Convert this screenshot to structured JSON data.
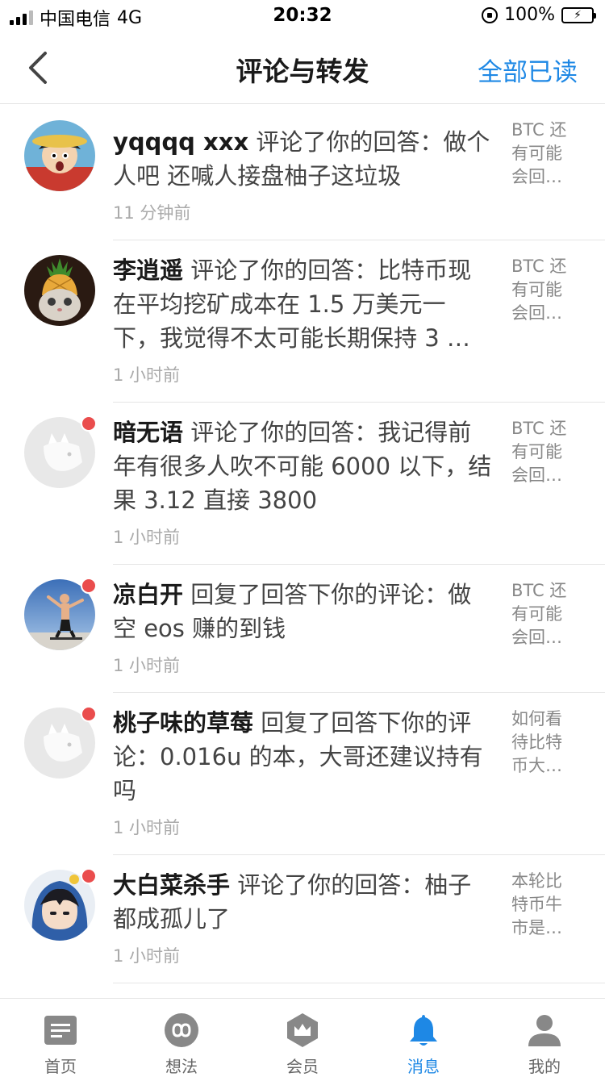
{
  "status_bar": {
    "carrier": "中国电信",
    "network": "4G",
    "time": "20:32",
    "battery": "100%"
  },
  "nav": {
    "title": "评论与转发",
    "action": "全部已读"
  },
  "notifications": [
    {
      "user": "yqqqq xxx",
      "action": "评论了你的回答：",
      "text": "做个人吧 还喊人接盘柚子这垃圾",
      "time": "11 分钟前",
      "source": "BTC 还有可能会回…",
      "unread": false,
      "avatar": "one-piece-avatar"
    },
    {
      "user": "李逍遥",
      "action": "评论了你的回答：",
      "text": "比特币现在平均挖矿成本在 1.5 万美元一下，我觉得不太可能长期保持 3 …",
      "time": "1 小时前",
      "source": "BTC 还有可能会回…",
      "unread": false,
      "avatar": "pineapple-cat-avatar"
    },
    {
      "user": "暗无语",
      "action": "评论了你的回答：",
      "text": "我记得前年有很多人吹不可能 6000 以下，结果 3.12 直接 3800",
      "time": "1 小时前",
      "source": "BTC 还有可能会回…",
      "unread": true,
      "avatar": "default-avatar"
    },
    {
      "user": "凉白开",
      "action": "回复了回答下你的评论：",
      "text": "做空 eos 赚的到钱",
      "time": "1 小时前",
      "source": "BTC 还有可能会回…",
      "unread": true,
      "avatar": "skateboarder-avatar"
    },
    {
      "user": "桃子味的草莓",
      "action": "回复了回答下你的评论：",
      "text": "0.016u 的本，大哥还建议持有吗",
      "time": "1 小时前",
      "source": "如何看待比特币大…",
      "unread": true,
      "avatar": "default-avatar"
    },
    {
      "user": "大白菜杀手",
      "action": "评论了你的回答：",
      "text": "柚子都成孤儿了",
      "time": "1 小时前",
      "source": "本轮比特币牛市是…",
      "unread": true,
      "avatar": "anime-hood-avatar"
    }
  ],
  "tabbar": {
    "tabs": [
      {
        "label": "首页",
        "icon": "home-icon",
        "active": false
      },
      {
        "label": "想法",
        "icon": "idea-icon",
        "active": false
      },
      {
        "label": "会员",
        "icon": "vip-icon",
        "active": false
      },
      {
        "label": "消息",
        "icon": "bell-icon",
        "active": true
      },
      {
        "label": "我的",
        "icon": "profile-icon",
        "active": false
      }
    ]
  },
  "colors": {
    "accent": "#1e88e5",
    "unread_dot": "#ea4d4d",
    "divider": "#e5e5e5"
  }
}
